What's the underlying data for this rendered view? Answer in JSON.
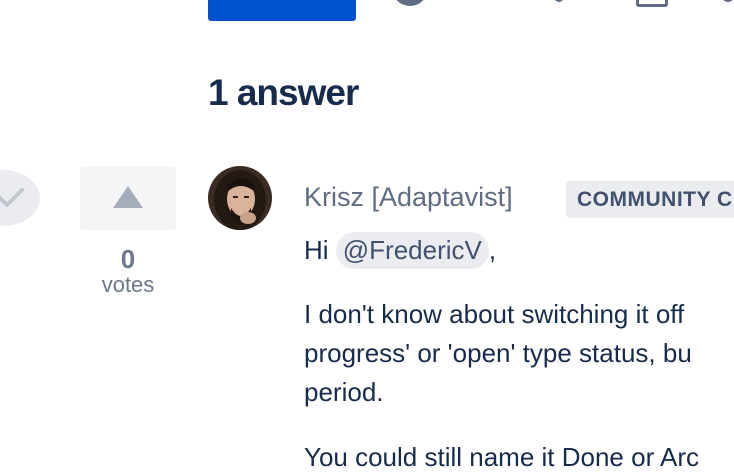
{
  "answers": {
    "heading": "1 answer"
  },
  "votes": {
    "count": "0",
    "label": "votes"
  },
  "answer": {
    "author": "Krisz [Adaptavist]",
    "badge": "COMMUNITY C",
    "greeting_prefix": "Hi ",
    "mention": "@FredericV",
    "greeting_suffix": ",",
    "paragraph1": [
      "I don't know about switching it off",
      "progress' or 'open' type status, bu",
      "period."
    ],
    "paragraph2": "You could still name it Done or Arc"
  },
  "colors": {
    "primary_button": "#0052cc",
    "muted_text": "#5e6c84",
    "chip_background": "#ebecf0",
    "text": "#172b4d"
  },
  "icons": {
    "accept": "checkmark-icon",
    "upvote": "triangle-up-icon"
  }
}
